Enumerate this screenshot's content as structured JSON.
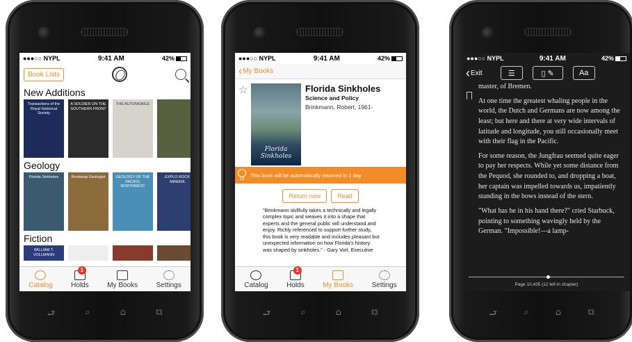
{
  "colors": {
    "accent": "#f28c28",
    "badge": "#e8372b",
    "reader_bg": "#1c1c1c"
  },
  "status": {
    "carrier": "●●●○○ NYPL",
    "time": "9:41 AM",
    "battery": "42%"
  },
  "hw_icons": [
    "back-icon",
    "search-icon",
    "home-icon",
    "recent-icon"
  ],
  "hw_glyphs": [
    "⮐",
    "⌕",
    "⌂",
    "⧉"
  ],
  "catalog": {
    "book_lists_button": "Book Lists",
    "sections": [
      {
        "title": "New Additions",
        "books": [
          {
            "label": "Transactions of the Royal Historical Society",
            "bg": "#1d2b5a"
          },
          {
            "label": "A SOLDIER ON THE SOUTHERN FRONT",
            "bg": "#2b2b2b"
          },
          {
            "label": "THE AUTOMOBILE",
            "bg": "#d5d3cc"
          },
          {
            "label": "",
            "bg": "#56603e"
          }
        ]
      },
      {
        "title": "Geology",
        "books": [
          {
            "label": "Florida Sinkholes",
            "bg": "#3a5a6f"
          },
          {
            "label": "Bootstrap Geologist",
            "bg": "#8b6a3c"
          },
          {
            "label": "GEOLOGY OF THE PACIFIC NORTHWEST",
            "bg": "#4a8fb7"
          },
          {
            "label": "EXPLO ROCK MINERA",
            "bg": "#2d3f6e"
          }
        ]
      },
      {
        "title": "Fiction",
        "books": [
          {
            "label": "WILLIAM T. VOLLMANN",
            "bg": "#2b3c7a"
          },
          {
            "label": "",
            "bg": "#eeeeee"
          },
          {
            "label": "",
            "bg": "#8a3a2a"
          },
          {
            "label": "",
            "bg": "#6a4a30"
          }
        ]
      }
    ]
  },
  "tabs": [
    {
      "label": "Catalog",
      "icon": "catalog-icon"
    },
    {
      "label": "Holds",
      "icon": "holds-icon",
      "badge": "1"
    },
    {
      "label": "My Books",
      "icon": "my-books-icon"
    },
    {
      "label": "Settings",
      "icon": "settings-icon"
    }
  ],
  "detail": {
    "back_label": "My Books",
    "title": "Florida Sinkholes",
    "subtitle": "Science and Policy",
    "author": "Brinkmann, Robert, 1961-",
    "cover_text": "Florida Sinkholes",
    "banner_days": "1d",
    "banner_text": "This book will be automatically returned in 1 day",
    "return_button": "Return now",
    "read_button": "Read",
    "description": "\"Brinkmann skillfully takes a technically and legally complex topic and weaves it into a shape that experts and the general public will understand and enjoy. Richly referenced to support further study, this book is very readable and includes pleasant but unexpected information on how Florida's history was shaped by sinkholes.\" - Gary Vorl, Executive"
  },
  "reader": {
    "exit_label": "Exit",
    "font_button": "Aa",
    "paragraphs": [
      "master, of Bremen.",
      "At one time the greatest whaling people in the world, the Dutch and Germans are now among the least; but here and there at very wide intervals of latitude and longitude, you still occasionally meet with their flag in the Pacific.",
      "For some reason, the Jungfrau seemed quite eager to pay her respects. While yet some distance from the Pequod, she rounded to, and dropping a boat, her captain was impelled towards us, impatiently standing in the bows instead of the stern.",
      "\"What has he in his hand there?\" cried Starbuck, pointing to something wavingly held by the German. \"Impossible!—a lamp-"
    ],
    "page_info": "Page 10,435 (12 left in chapter)",
    "progress": 0.5
  }
}
